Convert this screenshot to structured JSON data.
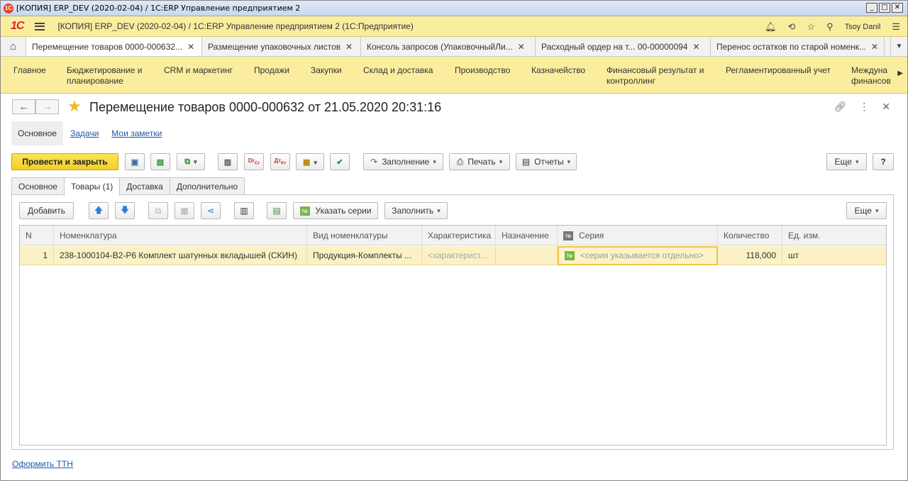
{
  "window": {
    "title": "[КОПИЯ] ERP_DEV (2020-02-04) / 1C:ERP Управление предприятием 2",
    "icon_text": "1С",
    "buttons": [
      "_",
      "□",
      "✕"
    ]
  },
  "app_header": {
    "logo": "1С",
    "title": "[КОПИЯ] ERP_DEV (2020-02-04) / 1C:ERP Управление предприятием 2  (1С:Предприятие)",
    "user": "Tsoy Danil"
  },
  "open_tabs": [
    {
      "label": "Перемещение товаров 0000-000632..."
    },
    {
      "label": "Размещение упаковочных листов"
    },
    {
      "label": "Консоль запросов (УпаковочныйЛи..."
    },
    {
      "label": "Расходный ордер на т...  00-00000094"
    },
    {
      "label": "Перенос остатков по старой номенк..."
    }
  ],
  "sections": [
    {
      "line1": "Главное",
      "line2": ""
    },
    {
      "line1": "Бюджетирование и",
      "line2": "планирование"
    },
    {
      "line1": "CRM и маркетинг",
      "line2": ""
    },
    {
      "line1": "Продажи",
      "line2": ""
    },
    {
      "line1": "Закупки",
      "line2": ""
    },
    {
      "line1": "Склад и доставка",
      "line2": ""
    },
    {
      "line1": "Производство",
      "line2": ""
    },
    {
      "line1": "Казначейство",
      "line2": ""
    },
    {
      "line1": "Финансовый результат и",
      "line2": "контроллинг"
    },
    {
      "line1": "Регламентированный учет",
      "line2": ""
    },
    {
      "line1": "Междуна",
      "line2": "финансов"
    }
  ],
  "form": {
    "title": "Перемещение товаров 0000-000632 от 21.05.2020 20:31:16",
    "subnav": [
      "Основное",
      "Задачи",
      "Мои заметки"
    ]
  },
  "toolbar": {
    "post_close": "Провести и закрыть",
    "fill": "Заполнение",
    "print": "Печать",
    "reports": "Отчеты",
    "more": "Еще",
    "help": "?",
    "dt_label": "Дт",
    "kt_label": "Кт",
    "dr_label": "Dr",
    "cr_label": "Cr"
  },
  "page_tabs": [
    "Основное",
    "Товары (1)",
    "Доставка",
    "Дополнительно"
  ],
  "goods_toolbar": {
    "add": "Добавить",
    "specify_series": "Указать серии",
    "fill": "Заполнить",
    "more": "Еще"
  },
  "table": {
    "columns": [
      "N",
      "Номенклатура",
      "Вид номенклатуры",
      "Характеристика",
      "Назначение",
      "Серия",
      "Количество",
      "Ед. изм."
    ],
    "rows": [
      {
        "n": "1",
        "nomenclature": "238-1000104-В2-Р6 Комплект шатунных вкладышей (СКИН)",
        "kind": "Продукция-Комплекты ...",
        "characteristic": "<характерист...",
        "purpose": "",
        "series": "<серия указывается отдельно>",
        "quantity": "118,000",
        "unit": "шт"
      }
    ]
  },
  "footer": {
    "ttn_link": "Оформить ТТН"
  },
  "colors": {
    "accent_yellow": "#fbed9e",
    "primary_button": "#f2cf25",
    "link": "#1f5aa5",
    "selected_row": "#fbf1c5"
  }
}
